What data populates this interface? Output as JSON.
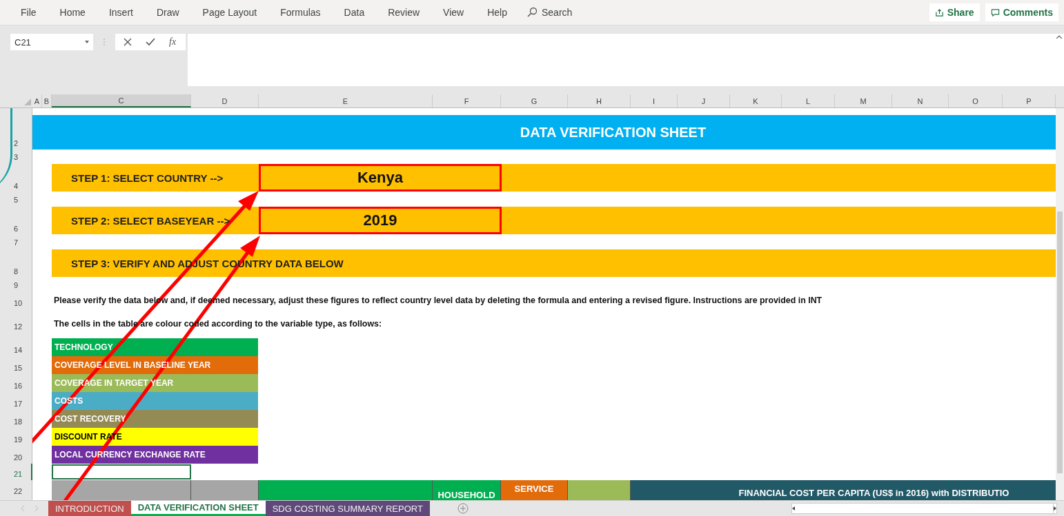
{
  "menu": [
    "File",
    "Home",
    "Insert",
    "Draw",
    "Page Layout",
    "Formulas",
    "Data",
    "Review",
    "View",
    "Help"
  ],
  "search": {
    "placeholder": "Search"
  },
  "share": "Share",
  "comments": "Comments",
  "name_box": "C21",
  "function_label": "fx",
  "columns": [
    {
      "label": "A",
      "selected": false
    },
    {
      "label": "B",
      "selected": false
    },
    {
      "label": "C",
      "selected": true
    },
    {
      "label": "D",
      "selected": false
    },
    {
      "label": "E",
      "selected": false
    },
    {
      "label": "F",
      "selected": false
    },
    {
      "label": "G",
      "selected": false
    },
    {
      "label": "H",
      "selected": false
    },
    {
      "label": "I",
      "selected": false
    },
    {
      "label": "J",
      "selected": false
    },
    {
      "label": "K",
      "selected": false
    },
    {
      "label": "L",
      "selected": false
    },
    {
      "label": "M",
      "selected": false
    },
    {
      "label": "N",
      "selected": false
    },
    {
      "label": "O",
      "selected": false
    },
    {
      "label": "P",
      "selected": false
    }
  ],
  "rows": [
    {
      "number": "2",
      "kind": "banner",
      "text": "DATA VERIFICATION SHEET"
    },
    {
      "number": "3",
      "kind": "blank"
    },
    {
      "number": "4",
      "kind": "step",
      "label": "STEP 1: SELECT COUNTRY -->",
      "value": "Kenya",
      "outlined": true
    },
    {
      "number": "5",
      "kind": "blank"
    },
    {
      "number": "6",
      "kind": "step",
      "label": "STEP 2: SELECT BASEYEAR -->",
      "value": "2019",
      "outlined": true
    },
    {
      "number": "7",
      "kind": "blank"
    },
    {
      "number": "8",
      "kind": "step",
      "label": "STEP 3: VERIFY AND ADJUST COUNTRY DATA BELOW"
    },
    {
      "number": "9",
      "kind": "blank"
    },
    {
      "number": "10",
      "kind": "text",
      "text": "Please verify the data below and, if deemed necessary, adjust these figures to reflect country level data by deleting the formula and entering a revised figure. Instructions are provided in INT"
    },
    {
      "kind": "gap"
    },
    {
      "number": "12",
      "kind": "text",
      "text": "The cells in the table are colour coded according to the variable type, as follows:"
    },
    {
      "kind": "gap"
    },
    {
      "number": "14",
      "kind": "legend",
      "text": "TECHNOLOGY",
      "color": "#00b050"
    },
    {
      "number": "15",
      "kind": "legend",
      "text": "COVERAGE LEVEL IN BASELINE YEAR",
      "color": "#e26b0a"
    },
    {
      "number": "16",
      "kind": "legend",
      "text": "COVERAGE IN TARGET YEAR",
      "color": "#9bbb59"
    },
    {
      "number": "17",
      "kind": "legend",
      "text": "COSTS",
      "color": "#4bacc6"
    },
    {
      "number": "18",
      "kind": "legend",
      "text": "COST RECOVERY",
      "color": "#948a54"
    },
    {
      "number": "19",
      "kind": "legend",
      "text": "DISCOUNT RATE",
      "color": "#ffff00"
    },
    {
      "number": "20",
      "kind": "legend",
      "text": "LOCAL CURRENCY EXCHANGE RATE",
      "color": "#7030a0"
    },
    {
      "number": "21",
      "kind": "active"
    },
    {
      "number": "22",
      "kind": "header",
      "cells": [
        {
          "color": "#a6a6a6"
        },
        {
          "color": "#a6a6a6"
        },
        {
          "color": "#00b050"
        },
        {
          "color": "#00b050",
          "text": "HOUSEHOLD"
        },
        {
          "color": "#e26b0a",
          "text": "SERVICE"
        },
        {
          "color": "#9bbb59"
        },
        {
          "color": "#215967",
          "text": "FINANCIAL COST PER CAPITA (US$ in 2016) with DISTRIBUTIO"
        }
      ]
    }
  ],
  "sheet_tabs": [
    {
      "label": "INTRODUCTION",
      "color": "#c0504d",
      "selected": false
    },
    {
      "label": "DATA VERIFICATION SHEET",
      "color": "#00b050",
      "selected": true
    },
    {
      "label": "SDG COSTING SUMMARY REPORT",
      "color": "#60497a",
      "selected": false
    }
  ]
}
